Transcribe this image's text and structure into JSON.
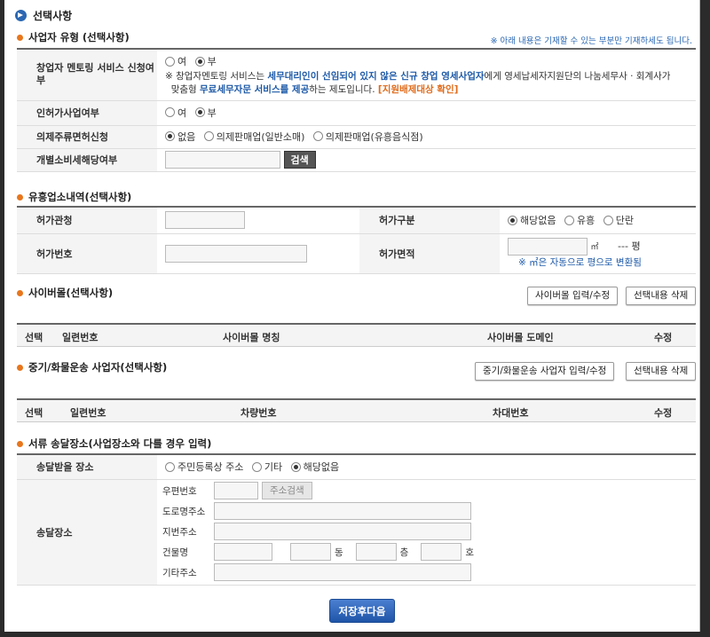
{
  "title": "선택사항",
  "business": {
    "heading": "사업자 유형 (선택사항)",
    "notice": "※ 아래 내용은 기재할 수 있는 부분만 기재하세도 됩니다.",
    "mentoring_label": "창업자 멘토링 서비스 신청여부",
    "mentoring_options": [
      "여",
      "부"
    ],
    "mentoring_selected": "부",
    "mentoring_note": {
      "p1": "※ 창업자멘토링 서비스는 ",
      "p2": "세무대리인이 선임되어 있지 않은 신규 창업 영세사업자",
      "p3": "에게 영세납세자지원단의 나눔세무사 · 회계사가",
      "p4": "맞춤형 ",
      "p5": "무료세무자문 서비스를 제공",
      "p6": "하는 제도입니다. ",
      "p7": "[지원배제대상 확인]"
    },
    "license_label": "인허가사업여부",
    "license_options": [
      "여",
      "부"
    ],
    "license_selected": "부",
    "liquor_label": "의제주류면허신청",
    "liquor_options": [
      "없음",
      "의제판매업(일반소매)",
      "의제판매업(유흥음식점)"
    ],
    "liquor_selected": "없음",
    "consumption_label": "개별소비세해당여부",
    "search_label": "검색"
  },
  "entertainment": {
    "heading": "유흥업소내역(선택사항)",
    "agency_label": "허가관청",
    "type_label": "허가구분",
    "type_options": [
      "해당없음",
      "유흥",
      "단란"
    ],
    "type_selected": "해당없음",
    "number_label": "허가번호",
    "area_label": "허가면적",
    "area_unit": "㎡",
    "pyeong_value": "---",
    "pyeong_unit": "평",
    "area_note": "※ ㎡은 자동으로 평으로 변환됨"
  },
  "cybermall": {
    "heading": "사이버몰(선택사항)",
    "input_btn": "사이버몰 입력/수정",
    "delete_btn": "선택내용 삭제",
    "columns": [
      "선택",
      "일련번호",
      "사이버몰 명칭",
      "사이버몰 도메인",
      "수정"
    ]
  },
  "vehicle": {
    "heading": "중기/화물운송 사업자(선택사항)",
    "input_btn": "중기/화물운송 사업자 입력/수정",
    "delete_btn": "선택내용 삭제",
    "columns": [
      "선택",
      "일련번호",
      "차량번호",
      "차대번호",
      "수정"
    ]
  },
  "delivery": {
    "heading": "서류 송달장소(사업장소와 다를 경우 입력)",
    "receive_label": "송달받을 장소",
    "receive_options": [
      "주민등록상 주소",
      "기타",
      "해당없음"
    ],
    "receive_selected": "해당없음",
    "place_label": "송달장소",
    "postal_label": "우편번호",
    "address_search": "주소검색",
    "road_label": "도로명주소",
    "lot_label": "지번주소",
    "building_label": "건물명",
    "dong": "동",
    "floor": "층",
    "unit": "호",
    "etc_label": "기타주소"
  },
  "save_label": "저장후다음"
}
